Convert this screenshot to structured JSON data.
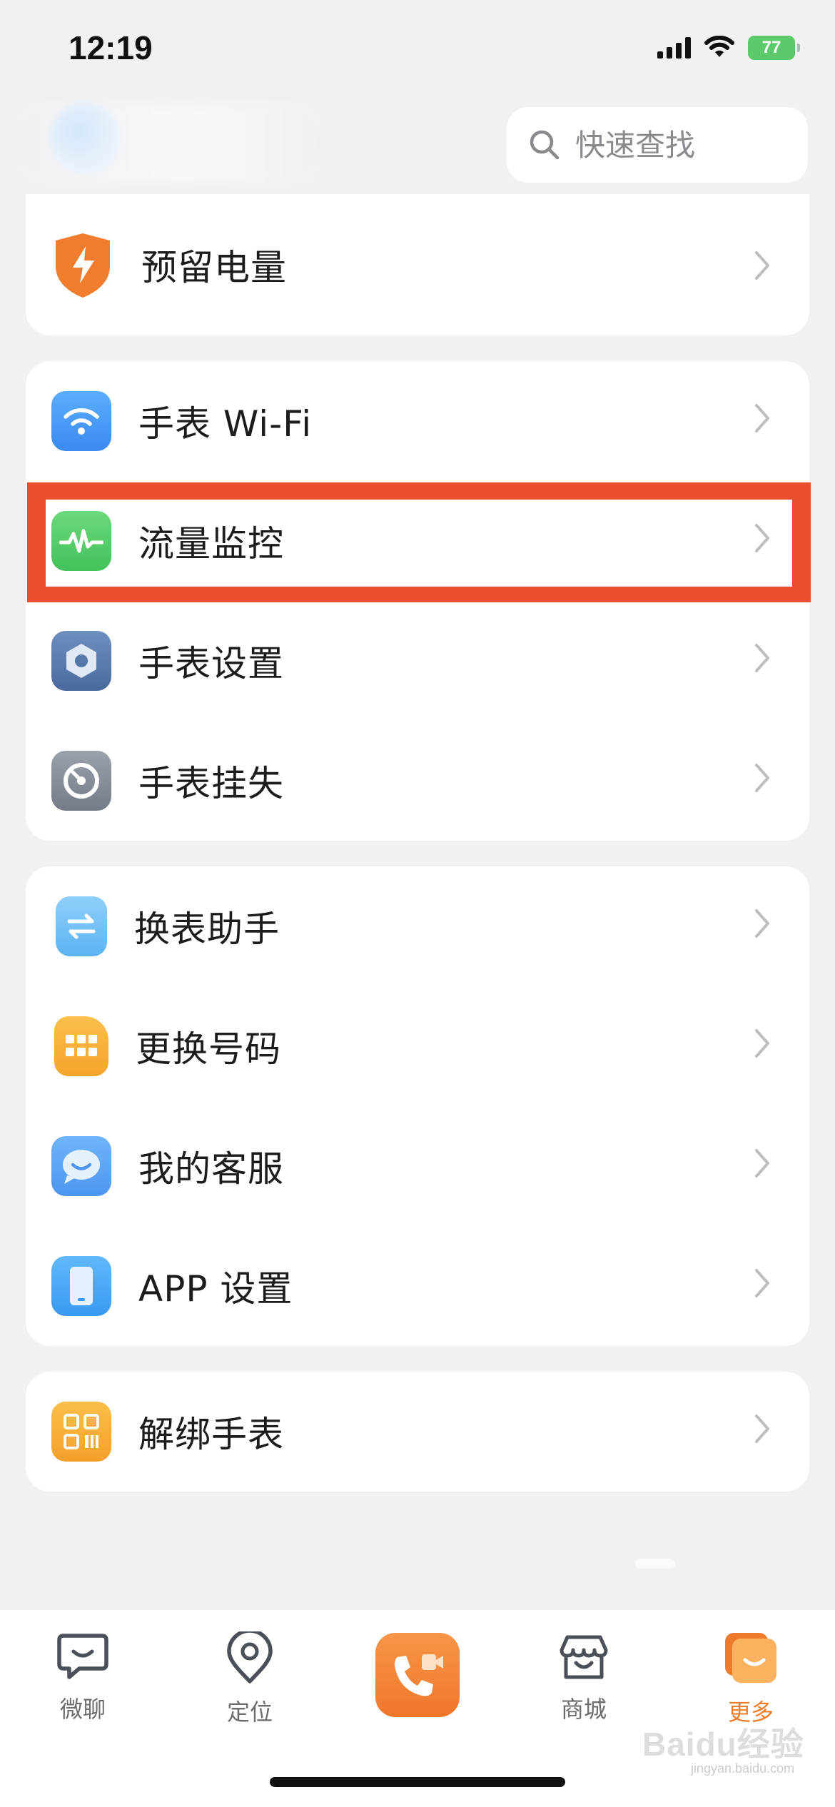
{
  "status_bar": {
    "time": "12:19",
    "battery": "77"
  },
  "header": {
    "search_placeholder": "快速查找"
  },
  "cards": [
    {
      "items": [
        {
          "label": "预留电量",
          "icon": "lightning-shield-icon"
        }
      ]
    },
    {
      "items": [
        {
          "label": "手表 Wi-Fi",
          "icon": "wifi-icon"
        },
        {
          "label": "流量监控",
          "icon": "pulse-icon"
        },
        {
          "label": "手表设置",
          "icon": "hexagon-gear-icon"
        },
        {
          "label": "手表挂失",
          "icon": "gauge-icon"
        }
      ]
    },
    {
      "items": [
        {
          "label": "换表助手",
          "icon": "swap-watch-icon"
        },
        {
          "label": "更换号码",
          "icon": "sim-card-icon"
        },
        {
          "label": "我的客服",
          "icon": "chat-bubble-icon"
        },
        {
          "label": "APP 设置",
          "icon": "phone-icon"
        }
      ]
    },
    {
      "items": [
        {
          "label": "解绑手表",
          "icon": "qr-code-icon"
        }
      ]
    }
  ],
  "tabbar": {
    "items": [
      {
        "label": "微聊",
        "icon": "chat-icon"
      },
      {
        "label": "定位",
        "icon": "location-pin-icon"
      },
      {
        "label": "",
        "icon": "video-call-icon"
      },
      {
        "label": "商城",
        "icon": "store-icon"
      },
      {
        "label": "更多",
        "icon": "more-icon"
      }
    ],
    "active_index": 4
  },
  "watermark": {
    "text": "Baidu经验",
    "sub": "jingyan.baidu.com"
  },
  "colors": {
    "accent": "#ef7d2a",
    "highlight": "#ea4f2e"
  }
}
